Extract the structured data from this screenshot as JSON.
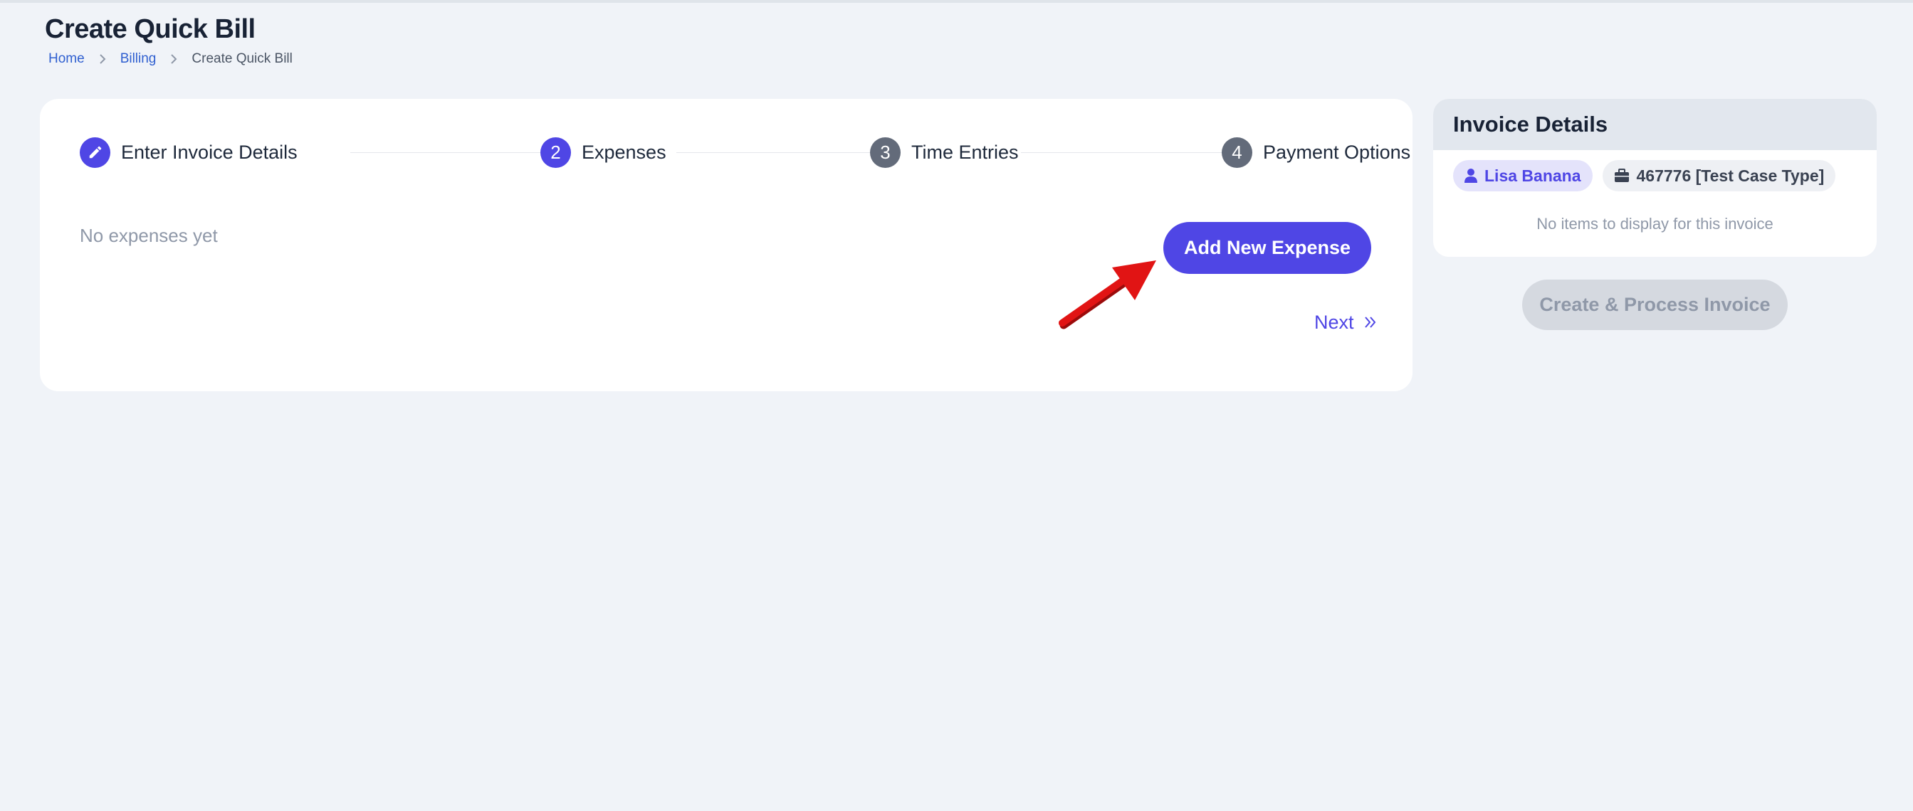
{
  "header": {
    "title": "Create Quick Bill",
    "breadcrumb": [
      "Home",
      "Billing",
      "Create Quick Bill"
    ]
  },
  "stepper": {
    "steps": [
      {
        "label": "Enter Invoice Details",
        "marker": "pencil-icon",
        "state": "completed"
      },
      {
        "label": "Expenses",
        "marker": "2",
        "state": "active"
      },
      {
        "label": "Time Entries",
        "marker": "3",
        "state": "pending"
      },
      {
        "label": "Payment Options",
        "marker": "4",
        "state": "pending"
      }
    ]
  },
  "expenses": {
    "empty_text": "No expenses yet",
    "add_button": "Add New Expense",
    "next_label": "Next"
  },
  "invoice_panel": {
    "title": "Invoice Details",
    "client_chip": "Lisa Banana",
    "case_chip": "467776 [Test Case Type]",
    "empty_text": "No items to display for this invoice",
    "create_button": "Create & Process Invoice",
    "create_button_disabled": true
  },
  "colors": {
    "accent": "#4f46e5",
    "background": "#f0f3f8",
    "pending_step": "#636b7a",
    "annotation_arrow": "#e11414"
  }
}
